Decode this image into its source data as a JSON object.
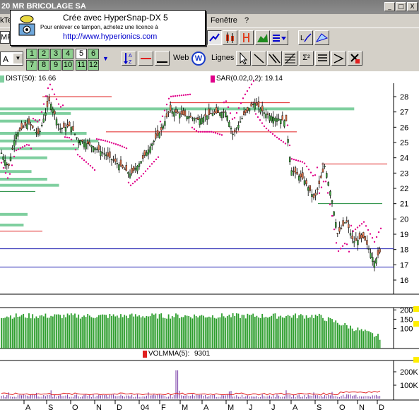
{
  "window": {
    "title": "20 MR BRICOLAGE SA",
    "buttons": [
      "_",
      "□",
      "X"
    ]
  },
  "menu": {
    "left_fragment": "kTe",
    "items": [
      "Fenêtre",
      "?"
    ]
  },
  "banner": {
    "line1": "Crée avec HyperSnap-DX 5",
    "line2": "Pour enlever ce tampon, achetez une licence à",
    "line3": "http://www.hyperionics.com"
  },
  "toolbar": {
    "left_fragment": "MR",
    "font_select": "A",
    "period_buttons": [
      "1",
      "2",
      "3",
      "4",
      "5",
      "6",
      "7",
      "8",
      "9",
      "10",
      "11",
      "12"
    ],
    "web_label": "Web",
    "web_icon": "W",
    "lines_label": "Lignes",
    "sigma_label": "Σ²"
  },
  "price_chart": {
    "indicator1": "DIST(50): 16.66",
    "indicator2": "SAR(0.02,0.2): 19.14",
    "y_ticks": [
      "28",
      "27",
      "26",
      "25",
      "24",
      "23",
      "22",
      "21",
      "20",
      "19",
      "18",
      "17",
      "16"
    ]
  },
  "volume_chart": {
    "y_ticks": [
      "200",
      "150",
      "100"
    ]
  },
  "volma_chart": {
    "label": "VOLMMA(5):",
    "value": "9301",
    "y_ticks": [
      "200K",
      "100K"
    ]
  },
  "x_axis": {
    "labels": [
      "A",
      "S",
      "O",
      "N",
      "D",
      "04",
      "F",
      "M",
      "A",
      "M",
      "J",
      "J",
      "A",
      "S",
      "O",
      "N",
      "D"
    ]
  },
  "colors": {
    "up_candle": "#3fa33f",
    "down_candle": "#e0734a",
    "sar": "#e0008a",
    "volume": "#2e9e2e",
    "distribution": "#7fcf9f"
  }
}
